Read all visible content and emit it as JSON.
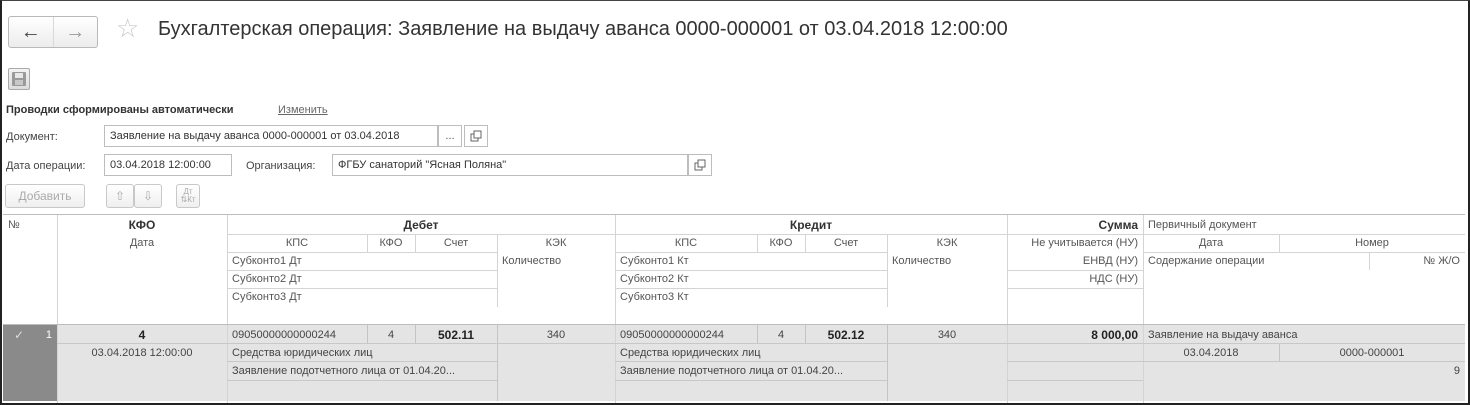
{
  "nav": {
    "back": "←",
    "forward": "→",
    "star": "☆"
  },
  "window": {
    "title": "Бухгалтерская операция: Заявление на выдачу аванса 0000-000001 от 03.04.2018 12:00:00"
  },
  "status": {
    "auto_text": "Проводки сформированы автоматически",
    "change_link": "Изменить"
  },
  "form": {
    "document_label": "Документ:",
    "document_value": "Заявление на выдачу аванса 0000-000001 от 03.04.2018",
    "ellipsis": "...",
    "date_label": "Дата операции:",
    "date_value": "03.04.2018 12:00:00",
    "org_label": "Организация:",
    "org_value": "ФГБУ санаторий \"Ясная Поляна\""
  },
  "toolbar": {
    "add_label": "Добавить",
    "up": "⇧",
    "down": "⇩",
    "swap": "Дт\n⇅Кт"
  },
  "table": {
    "headers": {
      "num": "№",
      "kfo": "КФО",
      "date": "Дата",
      "debit": "Дебет",
      "credit": "Кредит",
      "kps": "КПС",
      "kfo_short": "КФО",
      "account": "Счет",
      "kek": "КЭК",
      "subkonto1_dt": "Субконто1 Дт",
      "subkonto2_dt": "Субконто2 Дт",
      "subkonto3_dt": "Субконто3 Дт",
      "subkonto1_kt": "Субконто1 Кт",
      "subkonto2_kt": "Субконто2 Кт",
      "subkonto3_kt": "Субконто3 Кт",
      "quantity": "Количество",
      "sum": "Сумма",
      "not_counted": "Не учитывается (НУ)",
      "envd": "ЕНВД (НУ)",
      "nds": "НДС (НУ)",
      "primary_doc": "Первичный документ",
      "pd_date": "Дата",
      "pd_number": "Номер",
      "operation_content": "Содержание операции",
      "journal_no": "№ Ж/О"
    },
    "row": {
      "check": "✓",
      "num": "1",
      "kfo": "4",
      "date": "03.04.2018 12:00:00",
      "dt_kps": "09050000000000244",
      "dt_kfo": "4",
      "dt_account": "502.11",
      "dt_kek": "340",
      "dt_sub1": "Средства юридических лиц",
      "dt_sub2": "Заявление подотчетного лица от 01.04.20...",
      "kt_kps": "09050000000000244",
      "kt_kfo": "4",
      "kt_account": "502.12",
      "kt_kek": "340",
      "kt_sub1": "Средства юридических лиц",
      "kt_sub2": "Заявление подотчетного лица от 01.04.20...",
      "sum": "8 000,00",
      "primary_doc": "Заявление на выдачу аванса",
      "pd_date": "03.04.2018",
      "pd_number": "0000-000001",
      "journal_no": "9"
    }
  }
}
